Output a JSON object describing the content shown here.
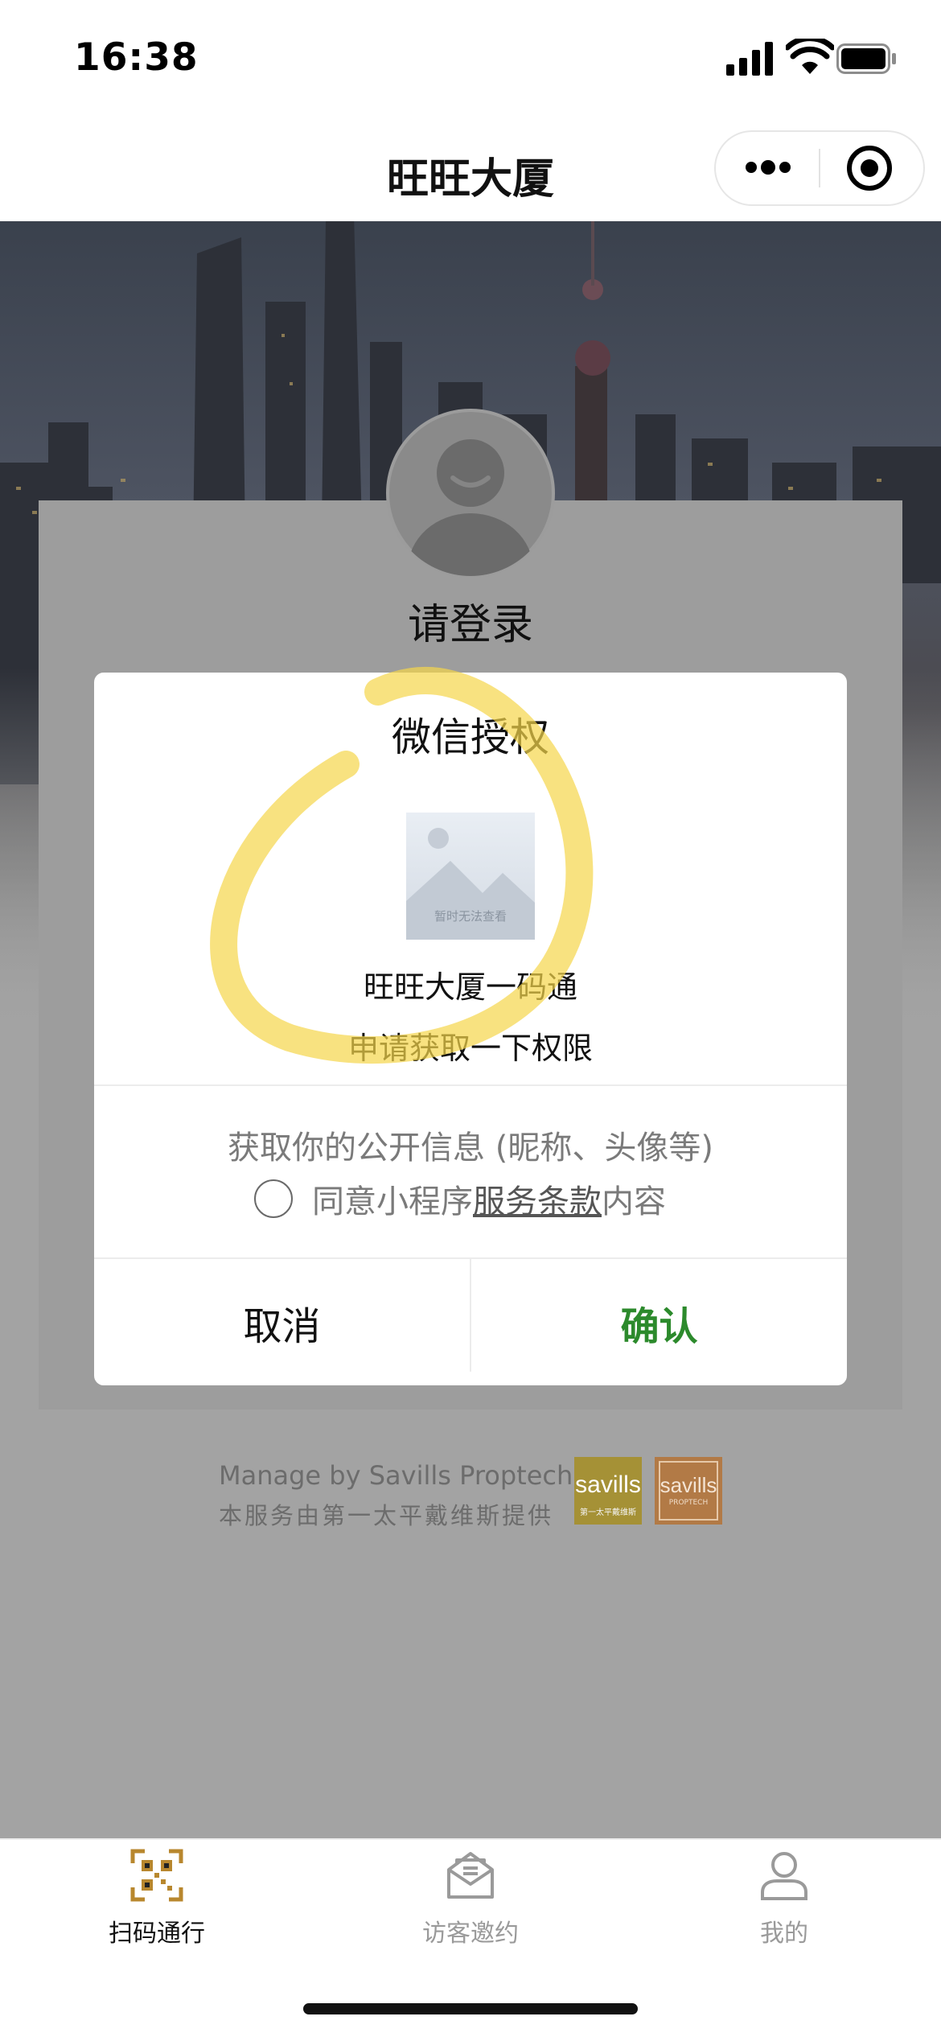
{
  "status_bar": {
    "time": "16:38"
  },
  "nav": {
    "title": "旺旺大厦"
  },
  "login": {
    "prompt": "请登录"
  },
  "dialog": {
    "title": "微信授权",
    "image_placeholder_text": "暂时无法查看",
    "app_name": "旺旺大厦一码通",
    "request_text": "申请获取一下权限",
    "info_text": "获取你的公开信息 (昵称、头像等)",
    "agree_prefix": "同意小程序",
    "terms_link": "服务条款",
    "agree_suffix": "内容",
    "cancel_label": "取消",
    "confirm_label": "确认",
    "agree_checked": false
  },
  "footer": {
    "manage_en": "Manage by Savills Proptech",
    "manage_cn": "本服务由第一太平戴维斯提供",
    "logo1_text": "savills",
    "logo1_sub": "第一太平戴维斯",
    "logo2_text": "savills",
    "logo2_sub": "PROPTECH"
  },
  "tabbar": {
    "items": [
      {
        "label": "扫码通行",
        "icon": "qr-scan-icon",
        "active": true
      },
      {
        "label": "访客邀约",
        "icon": "envelope-icon",
        "active": false
      },
      {
        "label": "我的",
        "icon": "user-icon",
        "active": false
      }
    ]
  },
  "colors": {
    "confirm": "#2c8a2c",
    "tab_active": "#b8872e",
    "tab_inactive": "#9a9a9a",
    "highlight": "#f5d54a"
  }
}
